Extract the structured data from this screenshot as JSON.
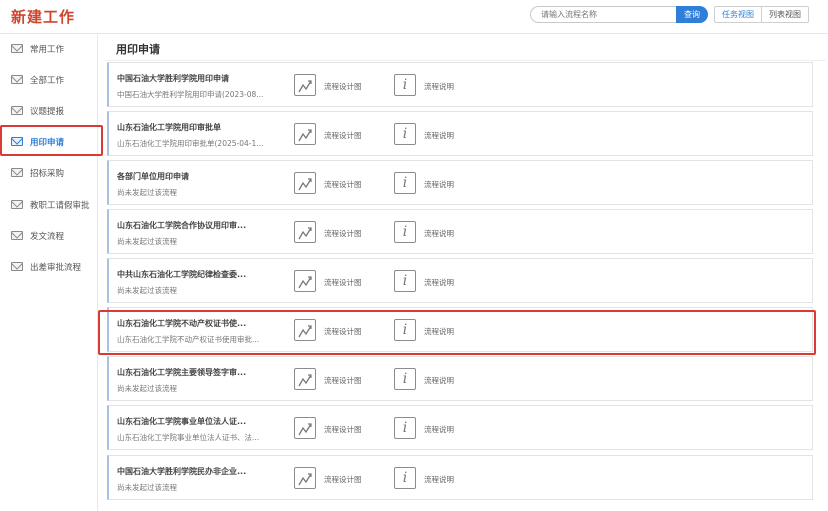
{
  "header": {
    "title": "新建工作",
    "search_placeholder": "请输入流程名称",
    "search_button": "查询",
    "view_task": "任务视图",
    "view_list": "列表视图"
  },
  "sidebar": {
    "items": [
      {
        "label": "常用工作",
        "icon": "mail-icon"
      },
      {
        "label": "全部工作",
        "icon": "mail-icon"
      },
      {
        "label": "议题提报",
        "icon": "mail-icon"
      },
      {
        "label": "用印申请",
        "icon": "mail-icon",
        "active": true
      },
      {
        "label": "招标采购",
        "icon": "mail-icon"
      },
      {
        "label": "教职工请假审批",
        "icon": "mail-icon"
      },
      {
        "label": "发文流程",
        "icon": "mail-icon"
      },
      {
        "label": "出差审批流程",
        "icon": "mail-icon"
      }
    ]
  },
  "main": {
    "title": "用印申请",
    "actions": {
      "design_label": "流程设计图",
      "desc_label": "流程说明",
      "design_icon": "line-chart-icon",
      "desc_icon": "info-icon"
    },
    "cards": [
      {
        "title": "中国石油大学胜利学院用印申请",
        "subtitle": "中国石油大学胜利学院用印申请(2023-08..."
      },
      {
        "title": "山东石油化工学院用印审批单",
        "subtitle": "山东石油化工学院用印审批单(2025-04-1..."
      },
      {
        "title": "各部门单位用印申请",
        "subtitle": "尚未发起过该流程"
      },
      {
        "title": "山东石油化工学院合作协议用印审...",
        "subtitle": "尚未发起过该流程"
      },
      {
        "title": "中共山东石油化工学院纪律检查委...",
        "subtitle": "尚未发起过该流程"
      },
      {
        "title": "山东石油化工学院不动产权证书使...",
        "subtitle": "山东石油化工学院不动产权证书使用审批..."
      },
      {
        "title": "山东石油化工学院主要领导签字审...",
        "subtitle": "尚未发起过该流程"
      },
      {
        "title": "山东石油化工学院事业单位法人证...",
        "subtitle": "山东石油化工学院事业单位法人证书、法..."
      },
      {
        "title": "中国石油大学胜利学院民办非企业...",
        "subtitle": "尚未发起过该流程"
      }
    ]
  },
  "colors": {
    "brand": "#d0452f",
    "accent": "#2f7fd8",
    "highlight": "#d83a36"
  }
}
